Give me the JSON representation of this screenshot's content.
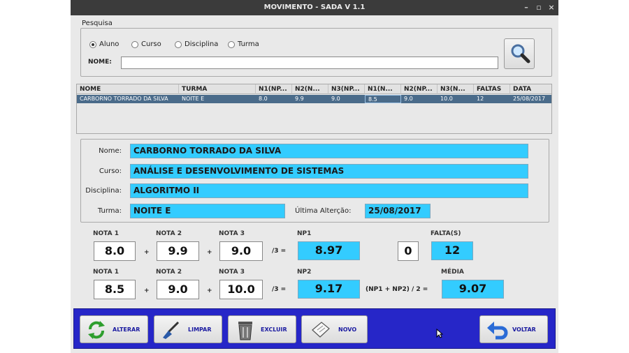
{
  "window": {
    "title": "MOVIMENTO - SADA V 1.1"
  },
  "search": {
    "group_label": "Pesquisa",
    "options": [
      "Aluno",
      "Curso",
      "Disciplina",
      "Turma"
    ],
    "selected": "Aluno",
    "name_label": "NOME:",
    "name_value": ""
  },
  "table": {
    "headers": [
      "NOME",
      "TURMA",
      "N1(NP...",
      "N2(N...",
      "N3(NP...",
      "N1(N...",
      "N2(NP...",
      "N3(N...",
      "FALTAS",
      "DATA"
    ],
    "rows": [
      [
        "CARBORNO TORRADO DA SILVA",
        "NOITE E",
        "8.0",
        "9.9",
        "9.0",
        "8.5",
        "9.0",
        "10.0",
        "12",
        "25/08/2017"
      ]
    ]
  },
  "details": {
    "nome_label": "Nome:",
    "nome": "CARBORNO TORRADO DA SILVA",
    "curso_label": "Curso:",
    "curso": "ANÁLISE E DESENVOLVIMENTO DE SISTEMAS",
    "disciplina_label": "Disciplina:",
    "disciplina": "ALGORITMO II",
    "turma_label": "Turma:",
    "turma": "NOITE E",
    "ult_label": "Última Alterção:",
    "ult": "25/08/2017"
  },
  "grades": {
    "np1": {
      "labels": [
        "NOTA 1",
        "NOTA 2",
        "NOTA 3"
      ],
      "values": [
        "8.0",
        "9.9",
        "9.0"
      ],
      "div": "/3 =",
      "result_label": "NP1",
      "result": "8.97"
    },
    "np2": {
      "labels": [
        "NOTA 1",
        "NOTA 2",
        "NOTA 3"
      ],
      "values": [
        "8.5",
        "9.0",
        "10.0"
      ],
      "div": "/3 =",
      "result_label": "NP2",
      "result": "9.17"
    },
    "plus": "+",
    "faltas_label": "FALTA(S)",
    "faltas_input": "0",
    "faltas": "12",
    "media_formula": "(NP1 + NP2) / 2 =",
    "media_label": "MÉDIA",
    "media": "9.07"
  },
  "buttons": {
    "alterar": "ALTERAR",
    "limpar": "LIMPAR",
    "excluir": "EXCLUIR",
    "novo": "NOVO",
    "voltar": "VOLTAR"
  }
}
